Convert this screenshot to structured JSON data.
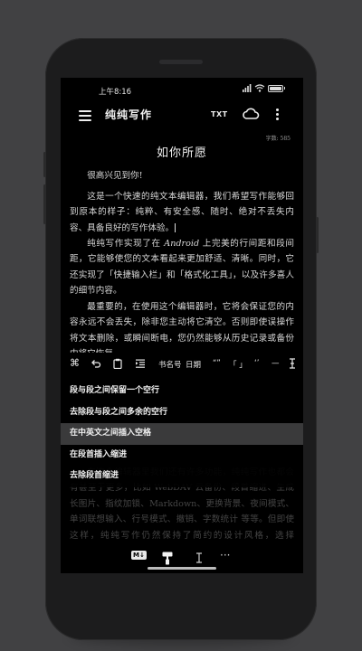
{
  "status": {
    "time": "上午8:16",
    "battery": "100"
  },
  "appbar": {
    "title": "纯纯写作",
    "txt_label": "TXT"
  },
  "document": {
    "word_count": "字数: 585",
    "title": "如你所愿",
    "p1": "很高兴见到你!",
    "p2": "这是一个快速的纯文本编辑器，我们希望写作能够回到原本的样子：纯粹、有安全感、随时、绝对不丢失内容、具备良好的写作体验。",
    "p3a": "纯纯写作实现了在",
    "p3em": "Android",
    "p3b": "上完美的行间距和段间距，它能够使您的文本看起来更加舒适、清晰。同时，它还实现了「快捷输入栏」和「格式化工具」，以及许多喜人的细节内容。",
    "p4": "最重要的，在使用这个编辑器时，它将会保证您的内容永远不会丢失，除非您主动将它清空。否则即使误操作将文本删除，或瞬间断电，您仍然能够从历史记录或备份中将它恢复。",
    "p5": "在这个编辑器里我们还有许多功能，纯纯写作也都会有甚至于更多，比如 WebDAV 云备份、段首缩进、生成长图片、指纹加锁、Markdown、更换背景、夜间模式、单词联想输入、行号模式、撤销、字数统计 等等。但即使这样，纯纯写作仍然保持了简约的设计风格，选择 Material Design 设计，希望它在下一个很长的时间里都能好好陪伴你，无论是日记、作业、论文、还是随手记录下来的生活点滴。"
  },
  "toolbar": {
    "book_quote": "书名号",
    "date": "日期",
    "quote_left": "“”",
    "bracket": "「 」",
    "single_quote": "‘’",
    "dash": "—"
  },
  "format_menu": {
    "items": [
      "段与段之间保留一个空行",
      "去除段与段之间多余的空行",
      "在中英文之间插入空格",
      "在段首插入缩进",
      "去除段首缩进"
    ],
    "selected_index": 2
  },
  "bottombar": {
    "md_label": "M↓",
    "more_label": "···"
  },
  "colors": {
    "background": "#414143",
    "screen": "#000000",
    "selected_row": "#3a3a3b"
  }
}
